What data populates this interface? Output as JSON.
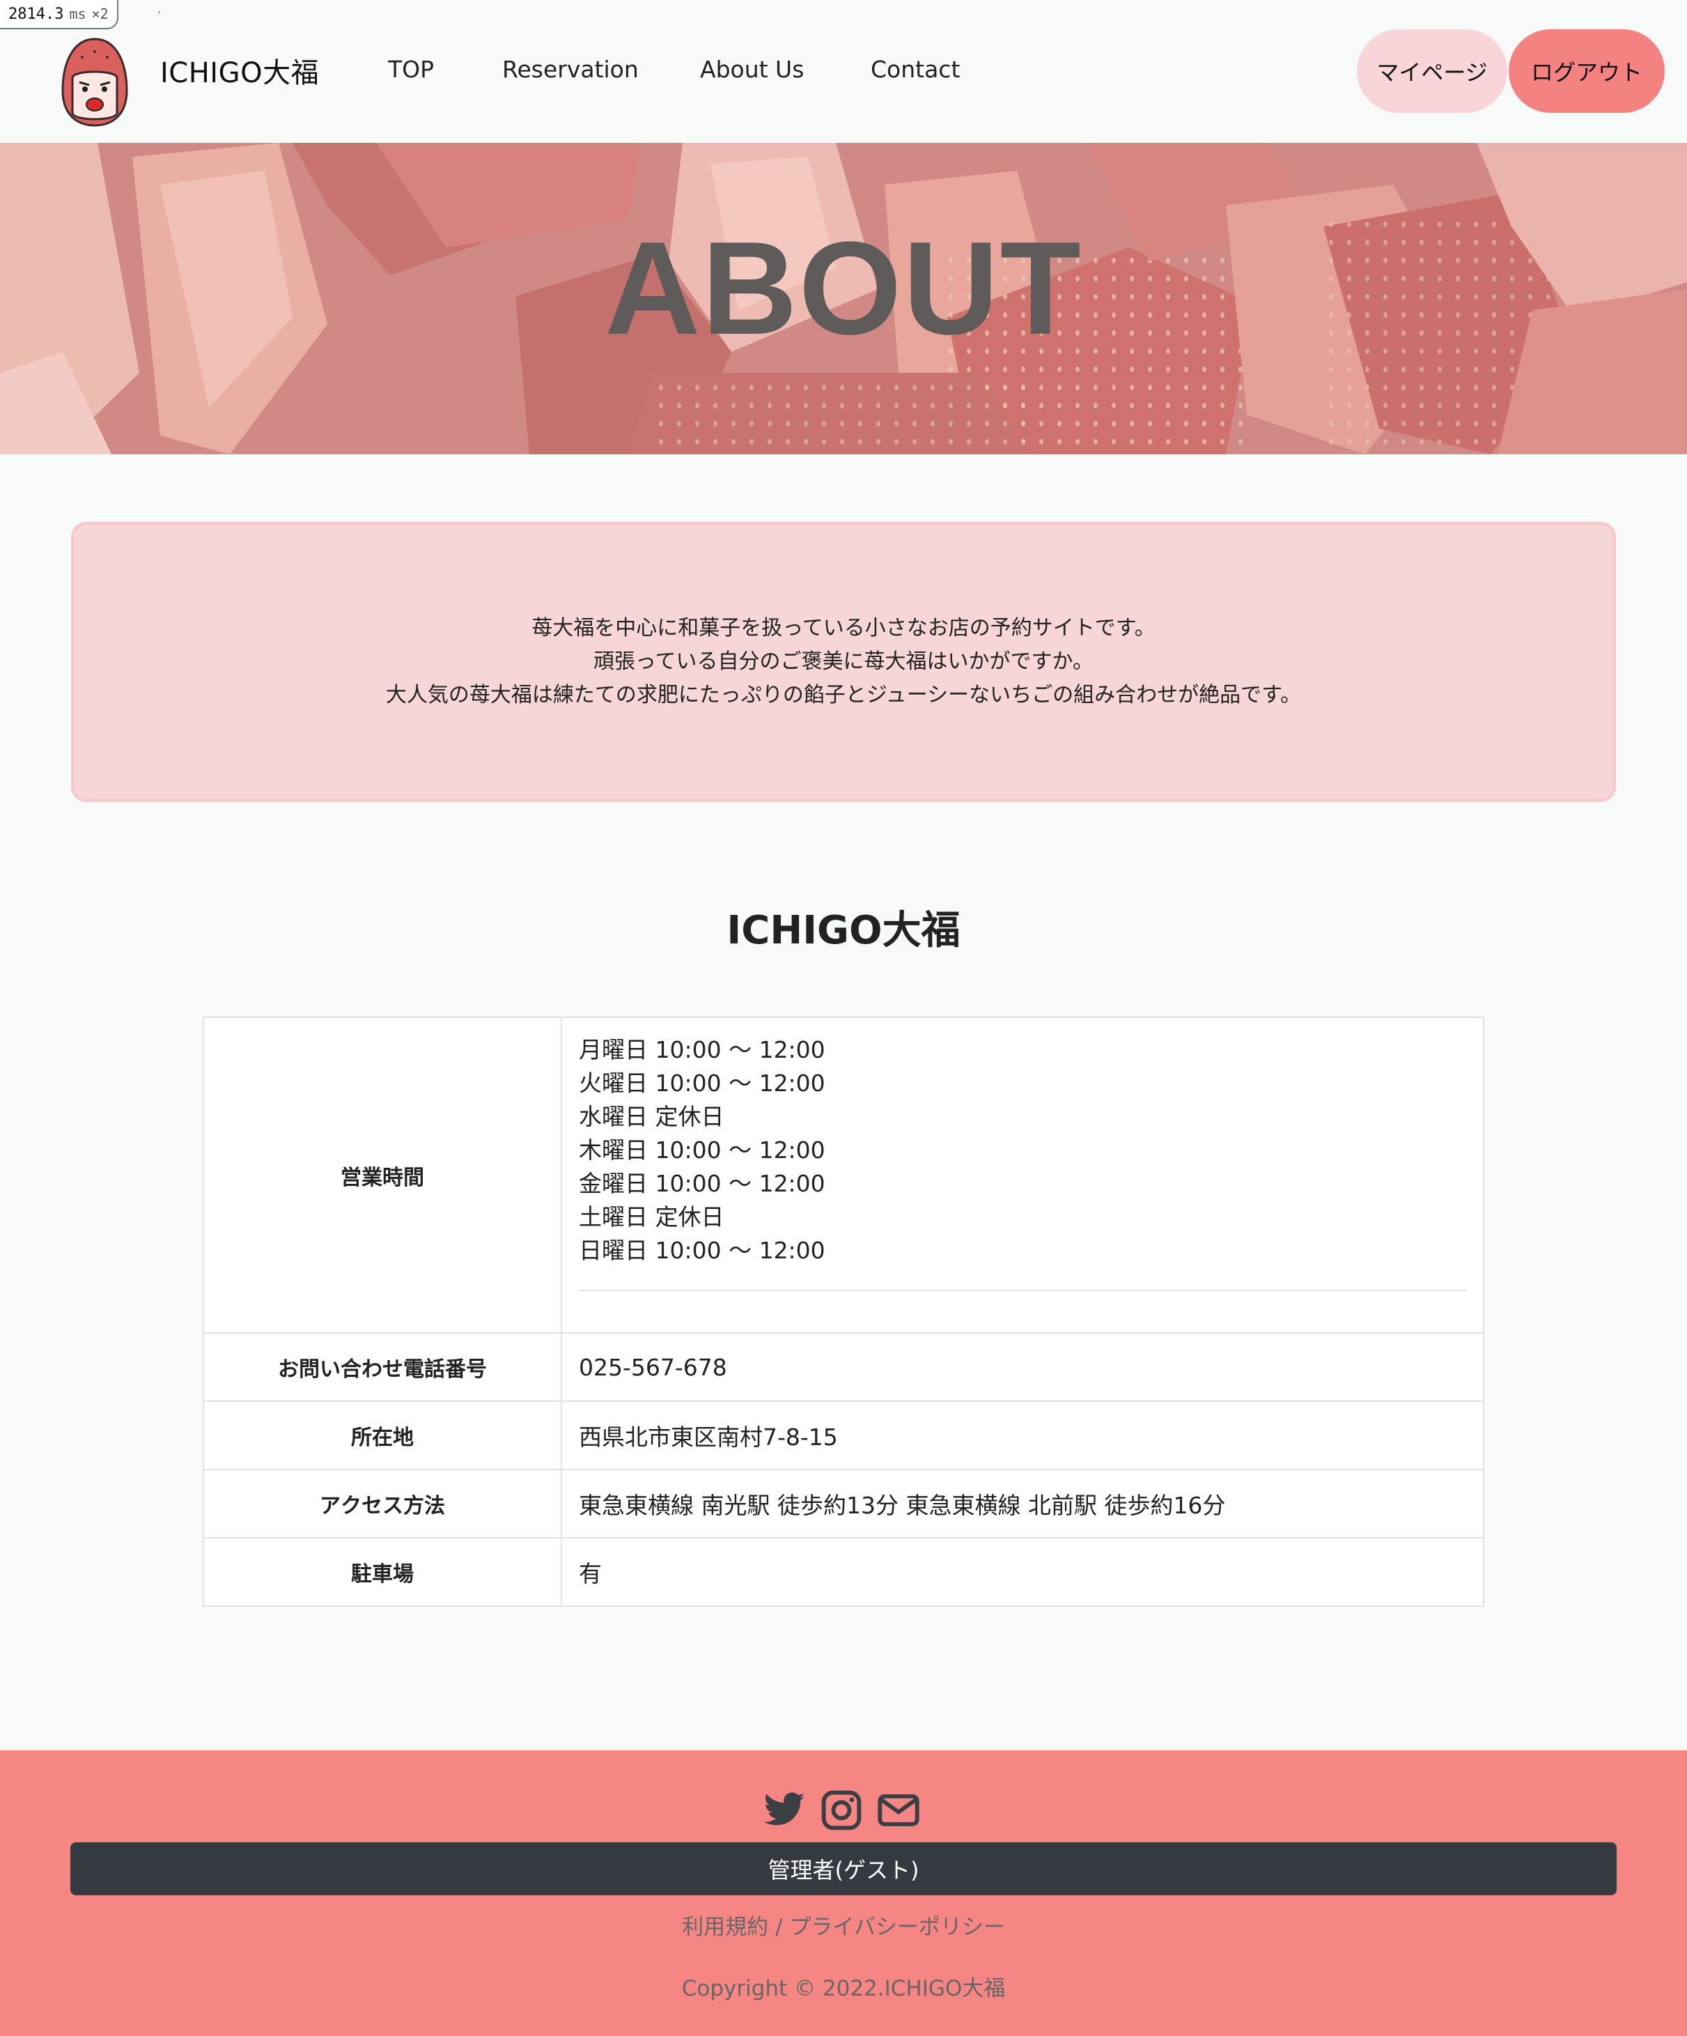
{
  "debug": {
    "time": "2814.3",
    "unit": "ms",
    "multiplier": "×2",
    "dot": "·"
  },
  "header": {
    "brand": "ICHIGO大福",
    "logo_icon": "strawberry-daifuku-mascot",
    "nav": {
      "top": "TOP",
      "reservation": "Reservation",
      "about": "About Us",
      "contact": "Contact"
    },
    "mypage_label": "マイページ",
    "logout_label": "ログアウト",
    "colors": {
      "mypage": "#f7d5d8",
      "logout": "#f48280"
    }
  },
  "hero": {
    "title": "ABOUT",
    "background": "strawberry-slices-photo"
  },
  "intro": {
    "lines": [
      "苺大福を中心に和菓子を扱っている小さなお店の予約サイトです。",
      "頑張っている自分のご褒美に苺大福はいかがですか。",
      "大人気の苺大福は練たての求肥にたっぷりの餡子とジューシーないちごの組み合わせが絶品です。"
    ]
  },
  "shop": {
    "name": "ICHIGO大福",
    "rows": {
      "hours_label": "営業時間",
      "hours": [
        "月曜日 10:00 〜 12:00",
        "火曜日 10:00 〜 12:00",
        "水曜日 定休日",
        "木曜日 10:00 〜 12:00",
        "金曜日 10:00 〜 12:00",
        "土曜日 定休日",
        "日曜日 10:00 〜 12:00"
      ],
      "phone_label": "お問い合わせ電話番号",
      "phone": "025-567-678",
      "address_label": "所在地",
      "address": "西県北市東区南村7-8-15",
      "access_label": "アクセス方法",
      "access": "東急東横線 南光駅 徒歩約13分 東急東横線 北前駅 徒歩約16分",
      "parking_label": "駐車場",
      "parking": "有"
    }
  },
  "footer": {
    "icons": [
      "twitter-icon",
      "instagram-icon",
      "mail-icon"
    ],
    "admin_label": "管理者(ゲスト)",
    "terms": "利用規約",
    "separator": "/",
    "privacy": "プライバシーポリシー",
    "copyright": "Copyright © 2022.ICHIGO大福",
    "colors": {
      "background": "#f58684",
      "admin_bar": "#353a40"
    }
  }
}
